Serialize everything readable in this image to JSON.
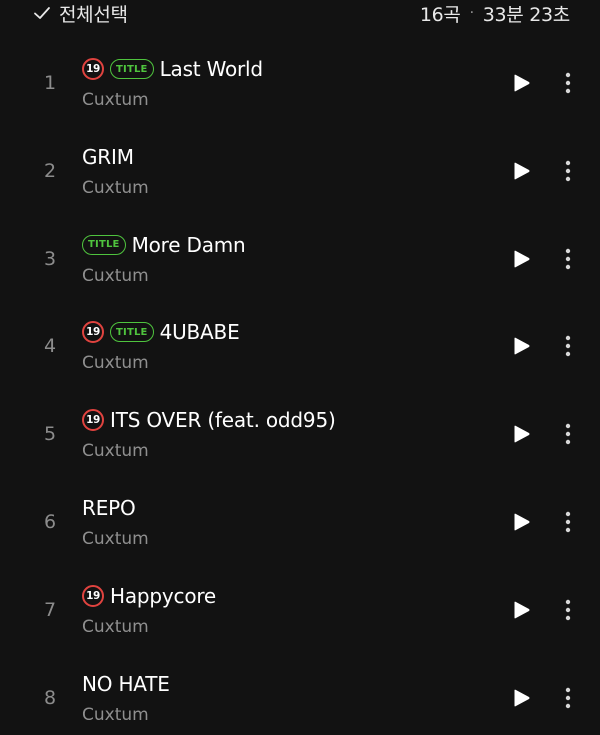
{
  "header": {
    "select_all_label": "전체선택",
    "track_count": "16곡",
    "separator": "·",
    "total_duration": "33분 23초"
  },
  "badges": {
    "explicit_label": "19",
    "title_label": "TITLE"
  },
  "colors": {
    "background": "#121212",
    "explicit_badge": "#e0433f",
    "title_badge": "#4fc43e",
    "artist_text": "#8f8f8f"
  },
  "tracks": [
    {
      "number": "1",
      "title": "Last World",
      "artist": "Cuxtum",
      "explicit": true,
      "is_title": true
    },
    {
      "number": "2",
      "title": "GRIM",
      "artist": "Cuxtum",
      "explicit": false,
      "is_title": false
    },
    {
      "number": "3",
      "title": "More Damn",
      "artist": "Cuxtum",
      "explicit": false,
      "is_title": true
    },
    {
      "number": "4",
      "title": "4UBABE",
      "artist": "Cuxtum",
      "explicit": true,
      "is_title": true
    },
    {
      "number": "5",
      "title": "ITS OVER (feat. odd95)",
      "artist": "Cuxtum",
      "explicit": true,
      "is_title": false
    },
    {
      "number": "6",
      "title": "REPO",
      "artist": "Cuxtum",
      "explicit": false,
      "is_title": false
    },
    {
      "number": "7",
      "title": "Happycore",
      "artist": "Cuxtum",
      "explicit": true,
      "is_title": false
    },
    {
      "number": "8",
      "title": "NO HATE",
      "artist": "Cuxtum",
      "explicit": false,
      "is_title": false
    }
  ],
  "icons": {
    "select_all": "check-icon",
    "play": "play-icon",
    "more": "more-vertical-icon"
  }
}
